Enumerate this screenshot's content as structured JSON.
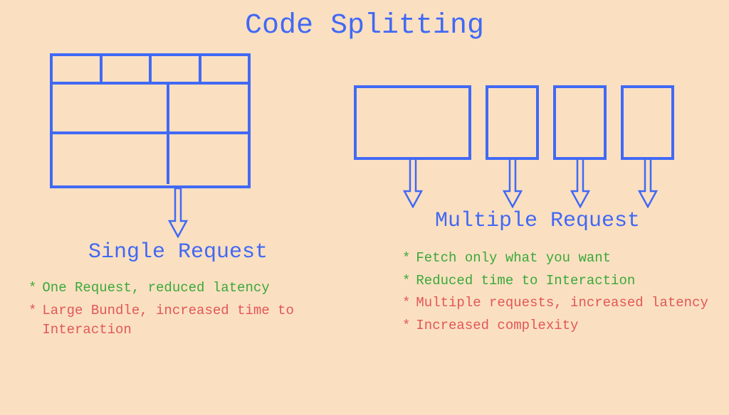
{
  "title": "Code Splitting",
  "left": {
    "heading": "Single Request",
    "pros": [
      "One Request, reduced latency"
    ],
    "cons": [
      "Large Bundle, increased time to Interaction"
    ]
  },
  "right": {
    "heading": "Multiple Request",
    "pros": [
      "Fetch only what you want",
      "Reduced time to Interaction"
    ],
    "cons": [
      "Multiple requests, increased latency",
      "Increased complexity"
    ]
  },
  "star": "*"
}
